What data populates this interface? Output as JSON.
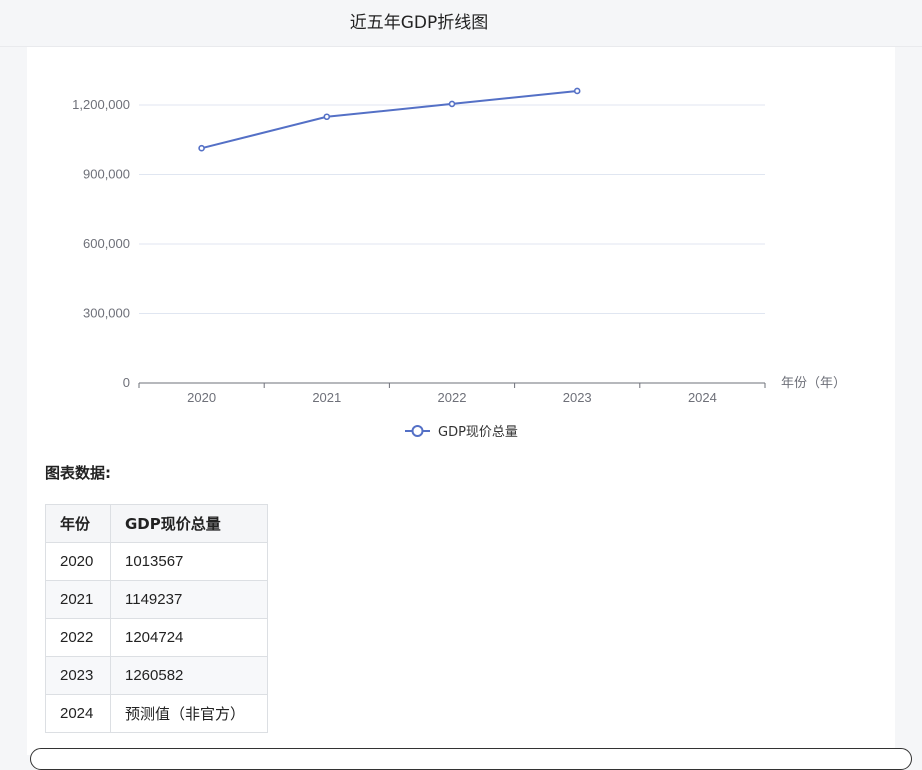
{
  "page": {
    "title": "近五年GDP折线图"
  },
  "chart_data": {
    "type": "line",
    "categories": [
      "2020",
      "2021",
      "2022",
      "2023",
      "2024"
    ],
    "series": [
      {
        "name": "GDP现价总量",
        "values": [
          1013567,
          1149237,
          1204724,
          1260582,
          null
        ],
        "color": "#5470c6"
      }
    ],
    "xlabel": "年份（年）",
    "ylabel": "",
    "ylim": [
      0,
      1200000
    ],
    "yticks": [
      0,
      300000,
      600000,
      900000,
      1200000
    ],
    "ytick_labels": [
      "0",
      "300,000",
      "600,000",
      "900,000",
      "1,200,000"
    ],
    "grid": true,
    "legend_position": "bottom-center"
  },
  "data_section": {
    "label": "图表数据:",
    "headers": [
      "年份",
      "GDP现价总量"
    ],
    "rows": [
      [
        "2020",
        "1013567"
      ],
      [
        "2021",
        "1149237"
      ],
      [
        "2022",
        "1204724"
      ],
      [
        "2023",
        "1260582"
      ],
      [
        "2024",
        "预测值（非官方）"
      ]
    ]
  }
}
